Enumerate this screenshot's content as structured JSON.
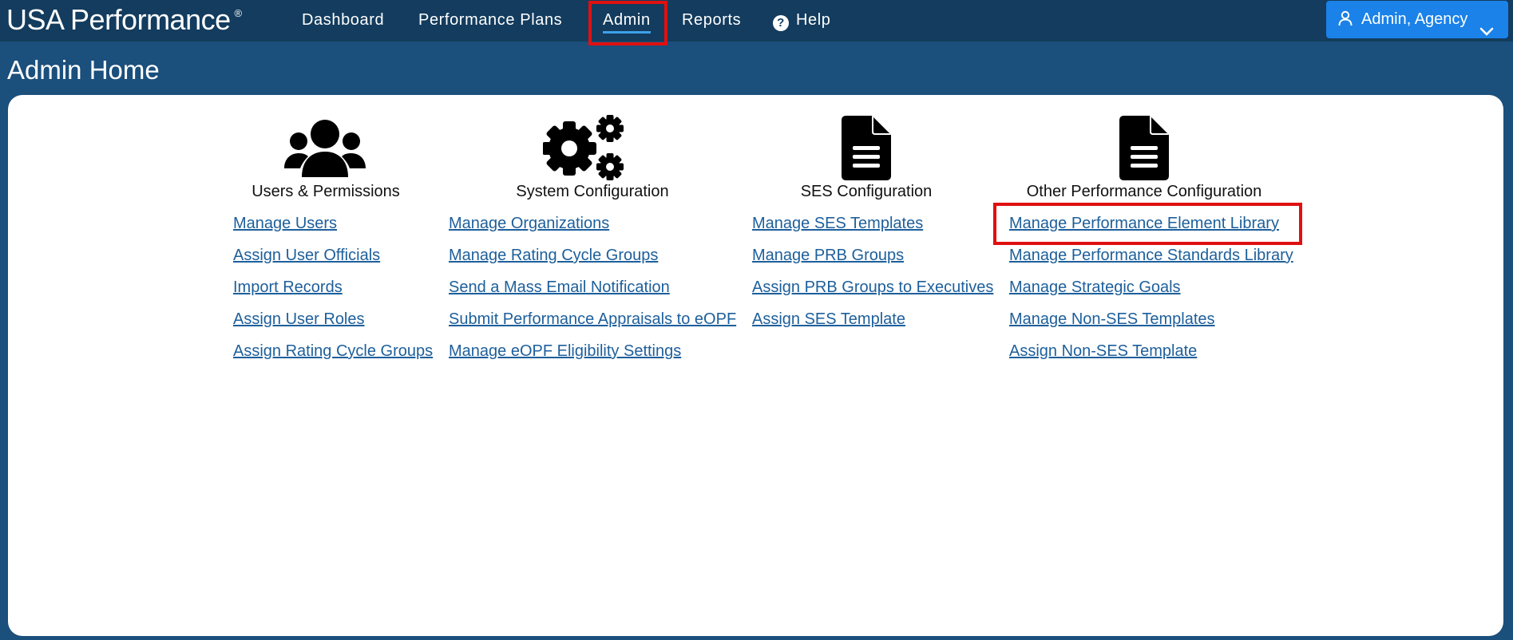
{
  "header": {
    "brand": "USA Performance",
    "brand_mark": "®",
    "nav": [
      {
        "label": "Dashboard"
      },
      {
        "label": "Performance Plans"
      },
      {
        "label": "Admin"
      },
      {
        "label": "Reports"
      },
      {
        "label": "Help"
      }
    ],
    "active_nav": "Admin",
    "user_menu_label": "Admin, Agency"
  },
  "page_title": "Admin Home",
  "sections": [
    {
      "title": "Users & Permissions",
      "icon": "users-icon",
      "links": [
        "Manage Users",
        "Assign User Officials",
        "Import Records",
        "Assign User Roles",
        "Assign Rating Cycle Groups"
      ]
    },
    {
      "title": "System Configuration",
      "icon": "gears-icon",
      "links": [
        "Manage Organizations",
        "Manage Rating Cycle Groups",
        "Send a Mass Email Notification",
        "Submit Performance Appraisals to eOPF",
        "Manage eOPF Eligibility Settings"
      ]
    },
    {
      "title": "SES Configuration",
      "icon": "document-icon",
      "links": [
        "Manage SES Templates",
        "Manage PRB Groups",
        "Assign PRB Groups to Executives",
        "Assign SES Template"
      ]
    },
    {
      "title": "Other Performance Configuration",
      "icon": "document-icon",
      "links": [
        "Manage Performance Element Library",
        "Manage Performance Standards Library",
        "Manage Strategic Goals",
        "Manage Non-SES Templates",
        "Assign Non-SES Template"
      ]
    }
  ],
  "colors": {
    "page_bg": "#1b4f7c",
    "topbar_bg": "#133c5e",
    "accent": "#1a82e8",
    "link": "#1d5f9b",
    "highlight": "#e01010"
  }
}
